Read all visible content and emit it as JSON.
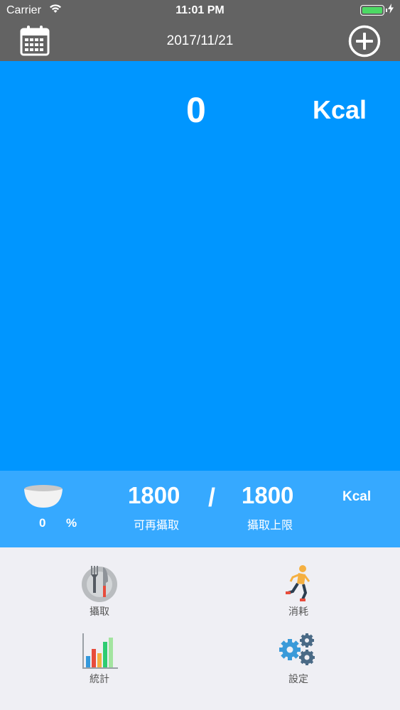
{
  "status_bar": {
    "carrier": "Carrier",
    "time": "11:01 PM",
    "battery_color": "#4cd964"
  },
  "nav": {
    "date": "2017/11/21",
    "left_icon": "calendar-icon",
    "right_icon": "add-circle-icon"
  },
  "main": {
    "kcal_value": "0",
    "kcal_unit": "Kcal",
    "background": "#0096ff"
  },
  "summary": {
    "percent_value": "0",
    "percent_unit": "%",
    "remaining_value": "1800",
    "remaining_label": "可再攝取",
    "separator": "/",
    "limit_value": "1800",
    "limit_label": "攝取上限",
    "unit": "Kcal",
    "background": "#36a9ff"
  },
  "menu": {
    "intake_label": "攝取",
    "burn_label": "消耗",
    "stats_label": "統計",
    "settings_label": "設定"
  }
}
